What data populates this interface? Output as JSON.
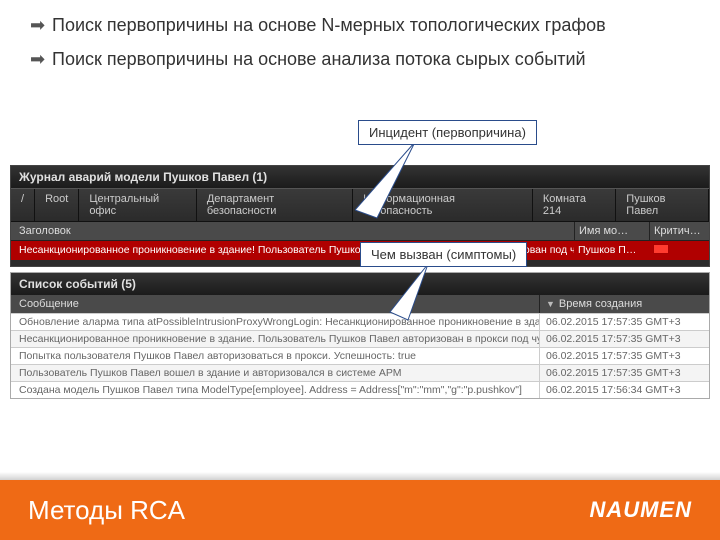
{
  "bullets": [
    "Поиск первопричины на основе N-мерных топологических графов",
    "Поиск первопричины на основе анализа потока сырых событий"
  ],
  "callouts": {
    "incident": "Инцидент (первопричина)",
    "symptoms": "Чем вызван (симптомы)"
  },
  "top_panel": {
    "title": "Журнал аварий модели Пушков Павел (1)",
    "crumbs": [
      "/",
      "Root",
      "Центральный офис",
      "Департамент безопасности",
      "Информационная безопасность",
      "Комната 214",
      "Пушков Павел"
    ],
    "columns": {
      "c1": "Заголовок",
      "c2": "Имя мо…",
      "c3": "Критич…"
    },
    "rows": [
      {
        "msg": "Несанкционированное проникновение в здание! Пользователь Пушков Павел вошел в здание (авторизован под чужой учетной записью)",
        "model": "Пушков П…",
        "sev": "red"
      },
      {
        "msg": "",
        "model": "",
        "sev": ""
      }
    ]
  },
  "bottom_panel": {
    "title": "Список событий (5)",
    "columns": {
      "c1": "Сообщение",
      "c2": "Время создания"
    },
    "rows": [
      {
        "msg": "Обновление аларма типа atPossibleIntrusionProxyWrongLogin: Несанкционированное проникновение в здание! Пользователь Пушков Павел …",
        "time": "06.02.2015 17:57:35 GMT+3"
      },
      {
        "msg": "Несанкционированное проникновение в здание. Пользователь Пушков Павел авторизован в прокси под чужой учетной записью",
        "time": "06.02.2015 17:57:35 GMT+3"
      },
      {
        "msg": "Попытка пользователя Пушков Павел авторизоваться в прокси. Успешность: true",
        "time": "06.02.2015 17:57:35 GMT+3"
      },
      {
        "msg": "Пользователь Пушков Павел вошел в здание и авторизовался в системе АРМ",
        "time": "06.02.2015 17:57:35 GMT+3"
      },
      {
        "msg": "Создана модель Пушков Павел типа ModelType[employee]. Address = Address[\"m\":\"mm\",\"g\":\"p.pushkov\"]",
        "time": "06.02.2015 17:56:34 GMT+3"
      }
    ]
  },
  "footer": {
    "title": "Методы RCA",
    "logo": "NAUMEN"
  }
}
